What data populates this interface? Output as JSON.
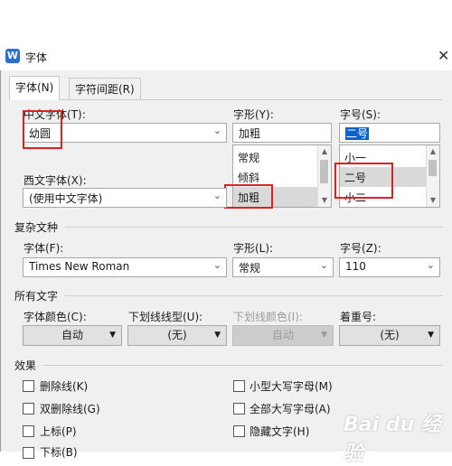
{
  "window": {
    "title": "字体",
    "app_icon_glyph": "W"
  },
  "tabs": [
    {
      "label": "字体(N)",
      "active": true
    },
    {
      "label": "字符间距(R)",
      "active": false
    }
  ],
  "chinese_font": {
    "label": "中文字体(T):",
    "value": "幼圆"
  },
  "western_font": {
    "label": "西文字体(X):",
    "value": "(使用中文字体)"
  },
  "style": {
    "label": "字形(Y):",
    "value": "加粗",
    "options": [
      "常规",
      "倾斜",
      "加粗"
    ],
    "selected": "加粗"
  },
  "size": {
    "label": "字号(S):",
    "value": "二号",
    "options": [
      "小一",
      "二号",
      "小二"
    ],
    "selected": "二号"
  },
  "complex": {
    "section": "复杂文种",
    "font_label": "字体(F):",
    "font_value": "Times New Roman",
    "style_label": "字形(L):",
    "style_value": "常规",
    "size_label": "字号(Z):",
    "size_value": "110"
  },
  "all_text": {
    "section": "所有文字",
    "color_label": "字体颜色(C):",
    "color_value": "自动",
    "underline_label": "下划线线型(U):",
    "underline_value": "(无)",
    "underline_color_label": "下划线颜色(I):",
    "underline_color_value": "自动",
    "emphasis_label": "着重号:",
    "emphasis_value": "(无)"
  },
  "effects": {
    "section": "效果",
    "left": [
      "删除线(K)",
      "双删除线(G)",
      "上标(P)",
      "下标(B)"
    ],
    "right": [
      "小型大写字母(M)",
      "全部大写字母(A)",
      "隐藏文字(H)"
    ]
  },
  "watermark": "Bai du 经验",
  "highlight_color": "#e02020"
}
